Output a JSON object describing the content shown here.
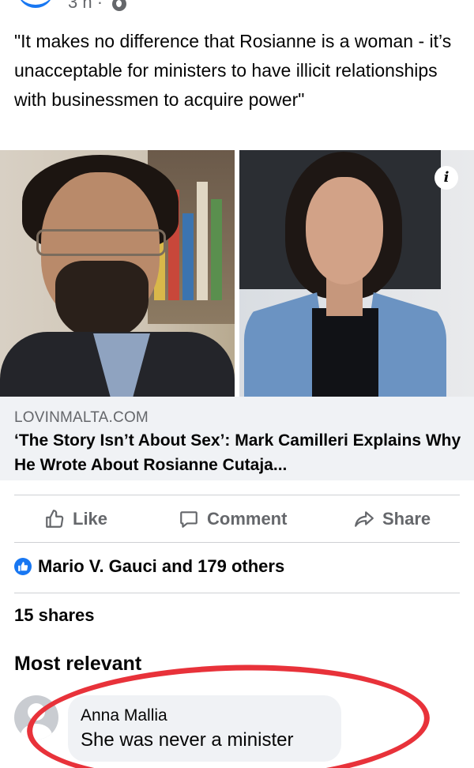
{
  "post": {
    "time": "3 h ·",
    "privacy_icon": "globe-icon",
    "text": "\"It makes no difference that Rosianne is a woman - it’s unacceptable for ministers to have illicit relationships with businessmen to acquire power\""
  },
  "link": {
    "domain": "LOVINMALTA.COM",
    "title": "‘The Story Isn’t About Sex’: Mark Camilleri Explains Why He Wrote About Rosianne Cutaja...",
    "info_icon": "i"
  },
  "actions": {
    "like": "Like",
    "comment": "Comment",
    "share": "Share"
  },
  "reactions": {
    "summary": "Mario V. Gauci and 179 others"
  },
  "shares": "15 shares",
  "comments": {
    "sort_label": "Most relevant",
    "items": [
      {
        "author": "Anna Mallia",
        "text": "She was never a minister"
      }
    ]
  },
  "colors": {
    "accent": "#1877f2",
    "annotation": "#e8323a",
    "secondary_text": "#65676b",
    "link_box": "#f0f2f5"
  }
}
